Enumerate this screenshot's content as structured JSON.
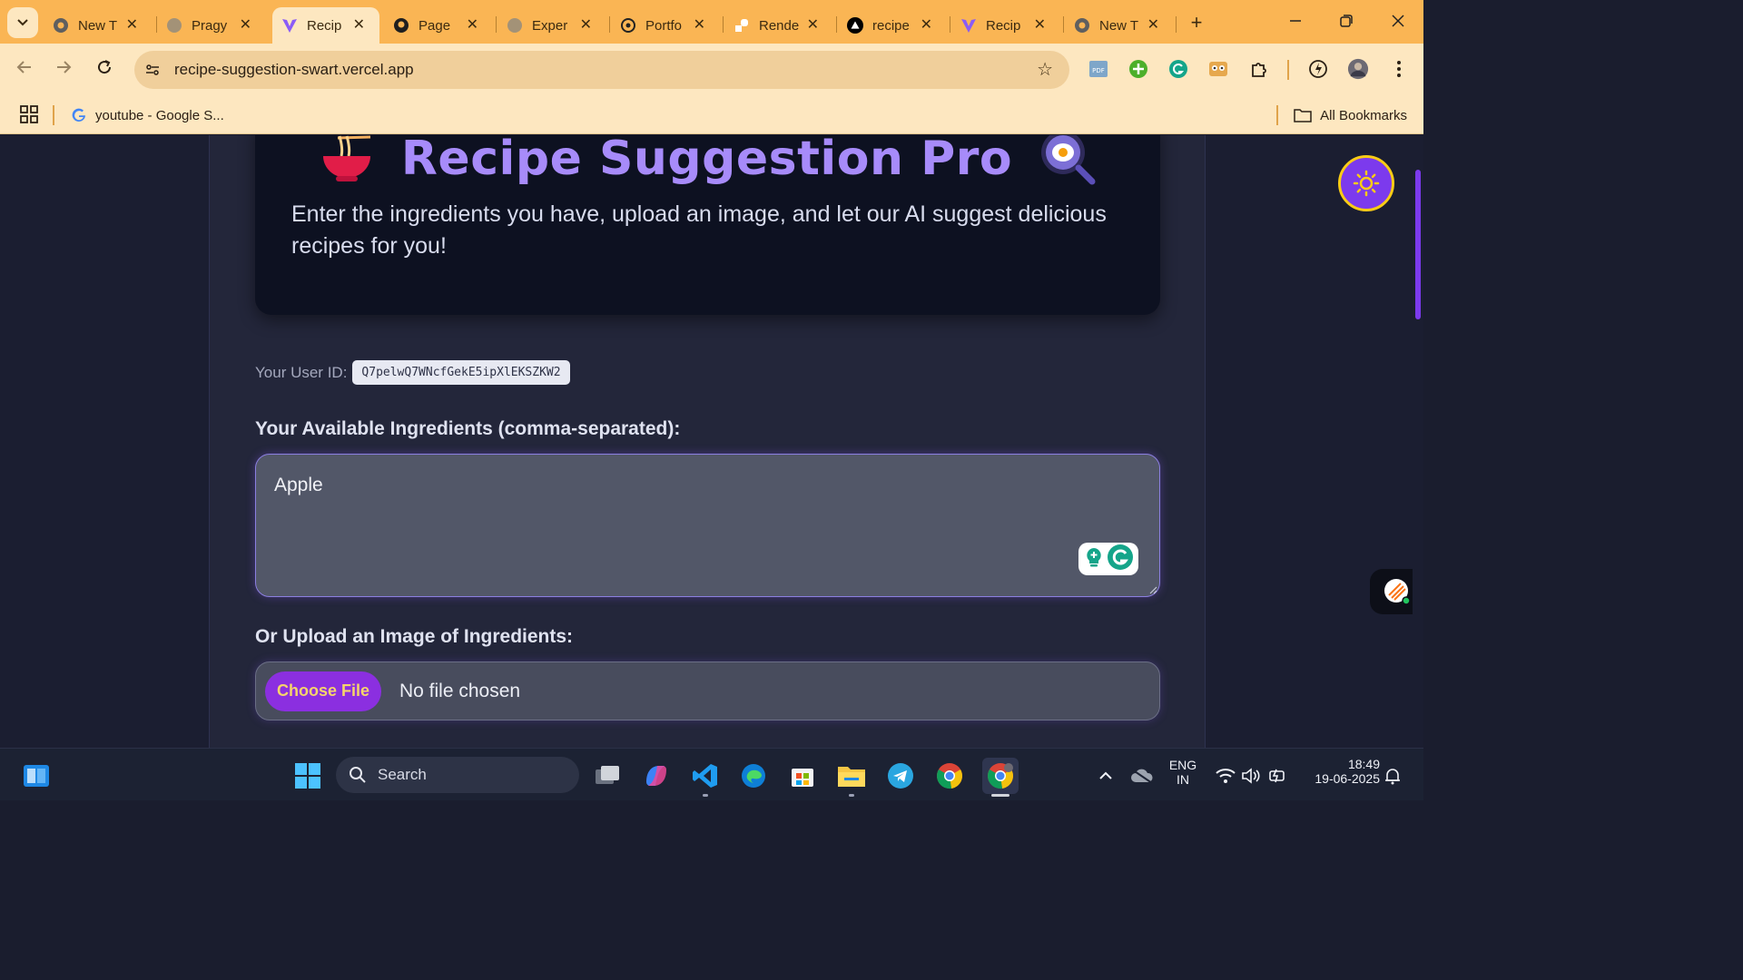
{
  "browser": {
    "tabs": [
      {
        "title": "New T",
        "icon": "chrome-icon"
      },
      {
        "title": "Pragy",
        "icon": "globe-icon"
      },
      {
        "title": "Recip",
        "icon": "vite-icon",
        "active": true
      },
      {
        "title": "Page",
        "icon": "github-icon"
      },
      {
        "title": "Exper",
        "icon": "globe-icon"
      },
      {
        "title": "Portfo",
        "icon": "openai-icon"
      },
      {
        "title": "Rende",
        "icon": "render-icon"
      },
      {
        "title": "recipe",
        "icon": "vercel-icon"
      },
      {
        "title": "Recip",
        "icon": "vite-icon"
      },
      {
        "title": "New T",
        "icon": "chrome-icon"
      }
    ],
    "url": "recipe-suggestion-swart.vercel.app",
    "bookmarks": {
      "item": "youtube - Google S...",
      "all_label": "All Bookmarks"
    },
    "accent_color": "#fab554"
  },
  "page": {
    "title": "Recipe Suggestion Pro",
    "title_left_icon": "noodle-bowl-icon",
    "title_right_icon": "fried-egg-pan-icon",
    "subtitle": "Enter the ingredients you have, upload an image, and let our AI suggest delicious recipes for you!",
    "user_id_label": "Your User ID:",
    "user_id": "Q7pelwQ7WNcfGekE5ipXlEKSZKW2",
    "ingredients_label": "Your Available Ingredients (comma-separated):",
    "ingredients_value": "Apple",
    "upload_label": "Or Upload an Image of Ingredients:",
    "choose_file_label": "Choose File",
    "no_file_label": "No file chosen",
    "title_color": "#a78bfa",
    "button_color": "#8b2fe0"
  },
  "taskbar": {
    "search_label": "Search",
    "lang_line1": "ENG",
    "lang_line2": "IN",
    "time": "18:49",
    "date": "19-06-2025"
  }
}
